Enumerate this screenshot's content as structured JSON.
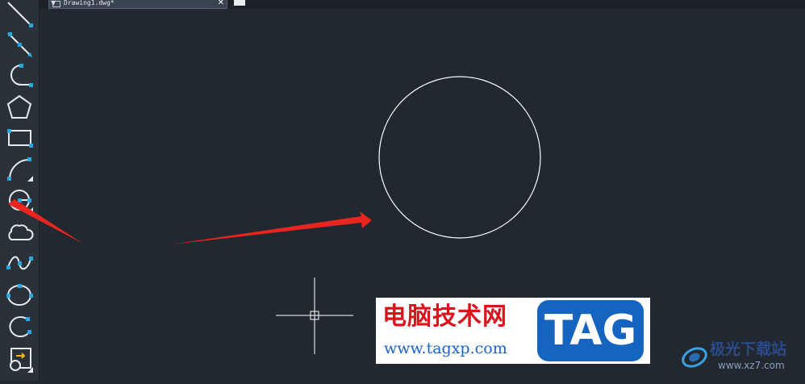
{
  "document_tab": {
    "label": "Drawing1.dwg*",
    "close_glyph": "✕",
    "dropdown_glyph": "▼"
  },
  "toolbar": {
    "tools": [
      {
        "name": "line-tool-icon"
      },
      {
        "name": "construction-line-tool-icon"
      },
      {
        "name": "polyline-tool-icon"
      },
      {
        "name": "polygon-tool-icon"
      },
      {
        "name": "rectangle-tool-icon"
      },
      {
        "name": "arc-tool-icon"
      },
      {
        "name": "circle-tool-icon"
      },
      {
        "name": "revision-cloud-tool-icon"
      },
      {
        "name": "spline-tool-icon"
      },
      {
        "name": "ellipse-tool-icon"
      },
      {
        "name": "ellipse-arc-tool-icon"
      },
      {
        "name": "insert-block-tool-icon"
      }
    ]
  },
  "banner": {
    "site_name": "电脑技术网",
    "site_url": "www.tagxp.com",
    "tag_text": "TAG"
  },
  "watermark": {
    "site_name": "极光下载站",
    "site_url": "www.xz7.com"
  },
  "colors": {
    "canvas_background": "#212830",
    "tool_icon": "#e6eaee",
    "tool_grip": "#2aa6e0",
    "drawing_stroke": "#ffffff",
    "annotation_arrow": "#e8251f",
    "tag_blue": "#1565c0",
    "banner_red": "#d9141c"
  }
}
